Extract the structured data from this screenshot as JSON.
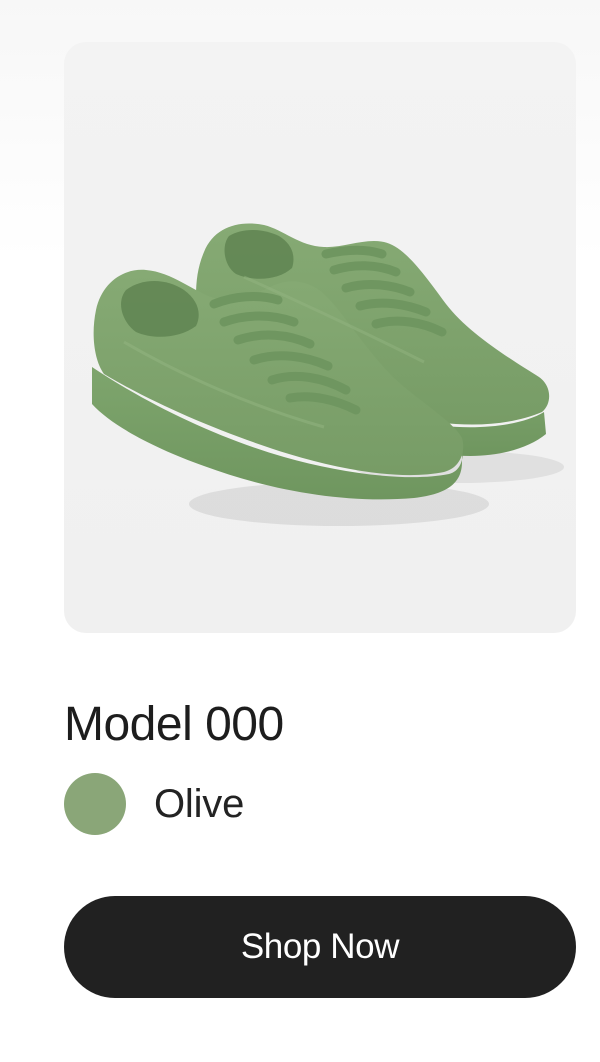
{
  "product": {
    "name": "Model 000",
    "color_name": "Olive",
    "swatch_color": "#8aa678",
    "shoe_color": "#7fa36d",
    "image_icon": "olive-sneakers-pair"
  },
  "actions": {
    "shop_label": "Shop Now"
  },
  "colors": {
    "button_background": "#212121",
    "button_text": "#ffffff",
    "text_primary": "#1d1d1d",
    "image_background": "#f1f1f1"
  }
}
